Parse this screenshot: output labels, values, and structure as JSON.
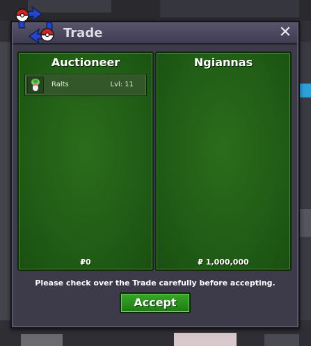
{
  "window": {
    "title": "Trade",
    "close_icon": "close-icon"
  },
  "left_panel": {
    "owner": "Auctioneer",
    "items": [
      {
        "name": "Ralts",
        "level": "Lvl: 11",
        "icon": "ralts-sprite-icon"
      }
    ],
    "money": "₽0"
  },
  "right_panel": {
    "owner": "Ngiannas",
    "items": [],
    "money": "₽ 1,000,000"
  },
  "footer": {
    "notice": "Please check over the Trade carefully before accepting.",
    "accept_label": "Accept"
  },
  "colors": {
    "panel_green": "#1f5a14",
    "dialog_bg": "#3d3a4a",
    "accept_green": "#2e9020",
    "logo_red": "#d42020",
    "logo_blue": "#2546c8"
  }
}
